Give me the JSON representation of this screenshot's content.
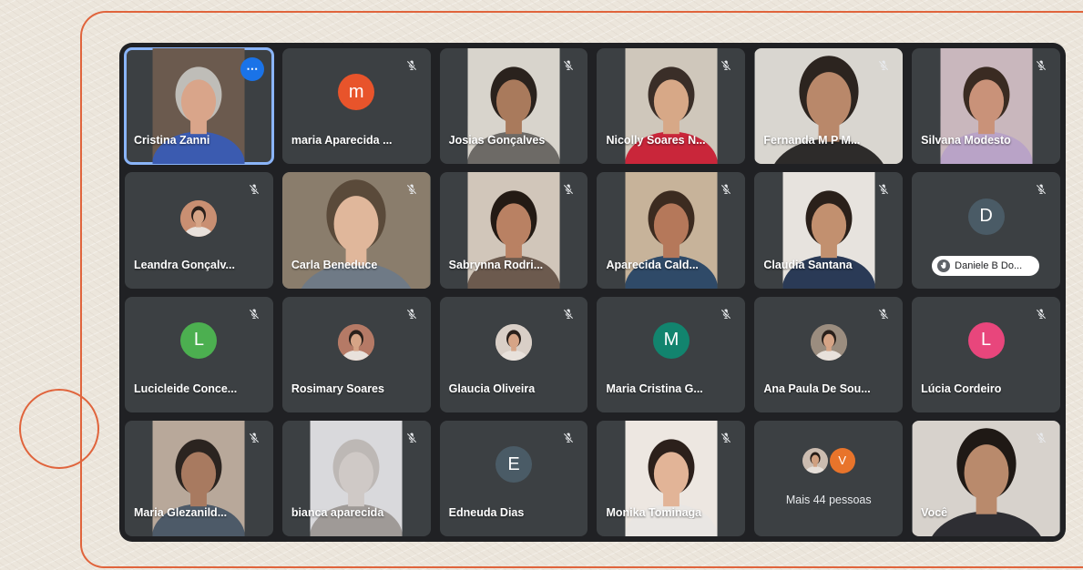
{
  "meeting": {
    "participants": [
      {
        "name": "Cristina Zanni",
        "type": "video",
        "active": true,
        "menu_label": "⋯",
        "bg": "#6b5a4e",
        "skin": "#d9a58a",
        "hair": "#bfbdb8",
        "shirt": "#3b5bb0"
      },
      {
        "name": "maria Aparecida ...",
        "type": "avatar",
        "initial": "m",
        "color": "#e8542b"
      },
      {
        "name": "Josias Gonçalves",
        "type": "video",
        "bg": "#d8d4cc",
        "skin": "#a97a5c",
        "hair": "#2a221d",
        "shirt": "#6d6a66"
      },
      {
        "name": "Nicolly Soares N...",
        "type": "video",
        "bg": "#cfc7bb",
        "skin": "#d7a887",
        "hair": "#3a2e28",
        "shirt": "#c9263a"
      },
      {
        "name": "Fernanda M P M...",
        "type": "video",
        "wide": true,
        "bg": "#d9d6d0",
        "skin": "#b9886a",
        "hair": "#2c241f",
        "shirt": "#2d2b2a"
      },
      {
        "name": "Silvana Modesto",
        "type": "video",
        "bg": "#c9b7bd",
        "skin": "#c99279",
        "hair": "#3a2b22",
        "shirt": "#b9a3c7"
      },
      {
        "name": "Leandra Gonçalv...",
        "type": "photo",
        "photo_bg": "#c98f72"
      },
      {
        "name": "Carla Beneduce",
        "type": "video",
        "wide": true,
        "bg": "#8a7d6c",
        "skin": "#e0b79b",
        "hair": "#5a4a3a",
        "shirt": "#6f7a86"
      },
      {
        "name": "Sabrynna Rodri...",
        "type": "video",
        "bg": "#d1c6ba",
        "skin": "#b98163",
        "hair": "#231a14",
        "shirt": "#6c5a4e"
      },
      {
        "name": "Aparecida Cald...",
        "type": "video",
        "bg": "#c7b39a",
        "skin": "#b5785a",
        "hair": "#3c2b20",
        "shirt": "#2f4a68"
      },
      {
        "name": "Claudia Santana",
        "type": "video",
        "bg": "#e7e3de",
        "skin": "#c2906f",
        "hair": "#2a201a",
        "shirt": "#2a3a56"
      },
      {
        "name": "Daniele B Do...",
        "type": "avatar_pill",
        "initial": "D",
        "color": "#4a5b66"
      },
      {
        "name": "Lucicleide Conce...",
        "type": "avatar",
        "initial": "L",
        "color": "#4caf50"
      },
      {
        "name": "Rosimary Soares",
        "type": "photo",
        "photo_bg": "#b57a66"
      },
      {
        "name": "Glaucia Oliveira",
        "type": "photo",
        "photo_bg": "#d9cfc7"
      },
      {
        "name": "Maria Cristina G...",
        "type": "avatar",
        "initial": "M",
        "color": "#12846e"
      },
      {
        "name": "Ana Paula De Sou...",
        "type": "photo",
        "photo_bg": "#9b8d7f"
      },
      {
        "name": "Lúcia Cordeiro",
        "type": "avatar",
        "initial": "L",
        "color": "#e8467c"
      },
      {
        "name": "Maria Glezanild...",
        "type": "video",
        "bg": "#b8a89a",
        "skin": "#a87a60",
        "hair": "#2b2420",
        "shirt": "#4d5a68"
      },
      {
        "name": "bianca aparecida",
        "type": "video",
        "bg": "#d9d9dc",
        "skin": "#cfc9c6",
        "hair": "#bdb8b5",
        "shirt": "#9f9a97"
      },
      {
        "name": "Edneuda Dias",
        "type": "avatar",
        "initial": "E",
        "color": "#4a5b66"
      },
      {
        "name": "Monika Tominaga",
        "type": "video",
        "bg": "#ede7e1",
        "skin": "#e2b497",
        "hair": "#2c201b",
        "shirt": "#e9e6e3"
      },
      {
        "name": "Mais 44 pessoas",
        "type": "more",
        "mini_initial": "V",
        "mini_color": "#e8742b"
      },
      {
        "name": "Você",
        "type": "video",
        "wide": true,
        "bg": "#d7d2cc",
        "skin": "#b98a6c",
        "hair": "#1f1915",
        "shirt": "#2e2e33"
      }
    ]
  },
  "icons": {
    "mic_off": "mic-off-icon",
    "more": "more-options-icon",
    "hand": "raised-hand-icon"
  },
  "colors": {
    "accent": "#e0643c",
    "grid_bg": "#202124",
    "tile_bg": "#3c4043"
  }
}
